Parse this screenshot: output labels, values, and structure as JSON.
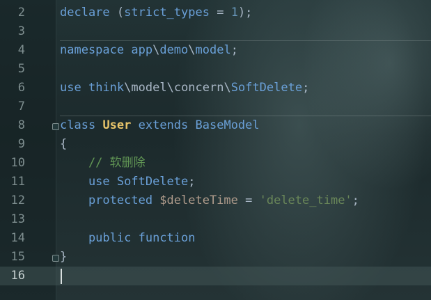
{
  "colors": {
    "keyword": "#6aa0d8",
    "class_name": "#e8c46a",
    "string": "#6a8759",
    "number": "#6897bb",
    "comment": "#629755",
    "line_number": "#7f8f90",
    "error_underline": "#d03030"
  },
  "editor": {
    "current_line": "16",
    "lines": [
      {
        "number": "2",
        "tokens": {
          "t1": "declare",
          "t2": " (",
          "t3": "strict_types",
          "t4": " = ",
          "t5": "1",
          "t6": ");"
        }
      },
      {
        "number": "3"
      },
      {
        "number": "4",
        "tokens": {
          "t1": "namespace",
          "t2": " app",
          "t3": "\\",
          "t4": "demo",
          "t5": "\\",
          "t6": "model",
          "t7": ";"
        }
      },
      {
        "number": "5"
      },
      {
        "number": "6",
        "tokens": {
          "t1": "use",
          "t2": " think",
          "t3": "\\",
          "t4": "model",
          "t5": "\\",
          "t6": "concern",
          "t7": "\\",
          "t8": "SoftDelete",
          "t9": ";"
        }
      },
      {
        "number": "7"
      },
      {
        "number": "8",
        "tokens": {
          "t1": "class",
          "t2": " ",
          "t3": "User",
          "t4": " extends",
          "t5": " BaseModel"
        }
      },
      {
        "number": "9",
        "tokens": {
          "t1": "{"
        }
      },
      {
        "number": "10",
        "tokens": {
          "t1": "    // 软删除"
        }
      },
      {
        "number": "11",
        "tokens": {
          "t1": "    use",
          "t2": " SoftDelete",
          "t3": ";"
        }
      },
      {
        "number": "12",
        "tokens": {
          "t1": "    protected",
          "t2": " $deleteTime",
          "t3": " = ",
          "t4": "'delete_time'",
          "t5": ";"
        }
      },
      {
        "number": "13"
      },
      {
        "number": "14",
        "tokens": {
          "t1": "    public",
          "t2": " function"
        }
      },
      {
        "number": "15",
        "tokens": {
          "t1": "}"
        }
      },
      {
        "number": "16"
      }
    ]
  }
}
